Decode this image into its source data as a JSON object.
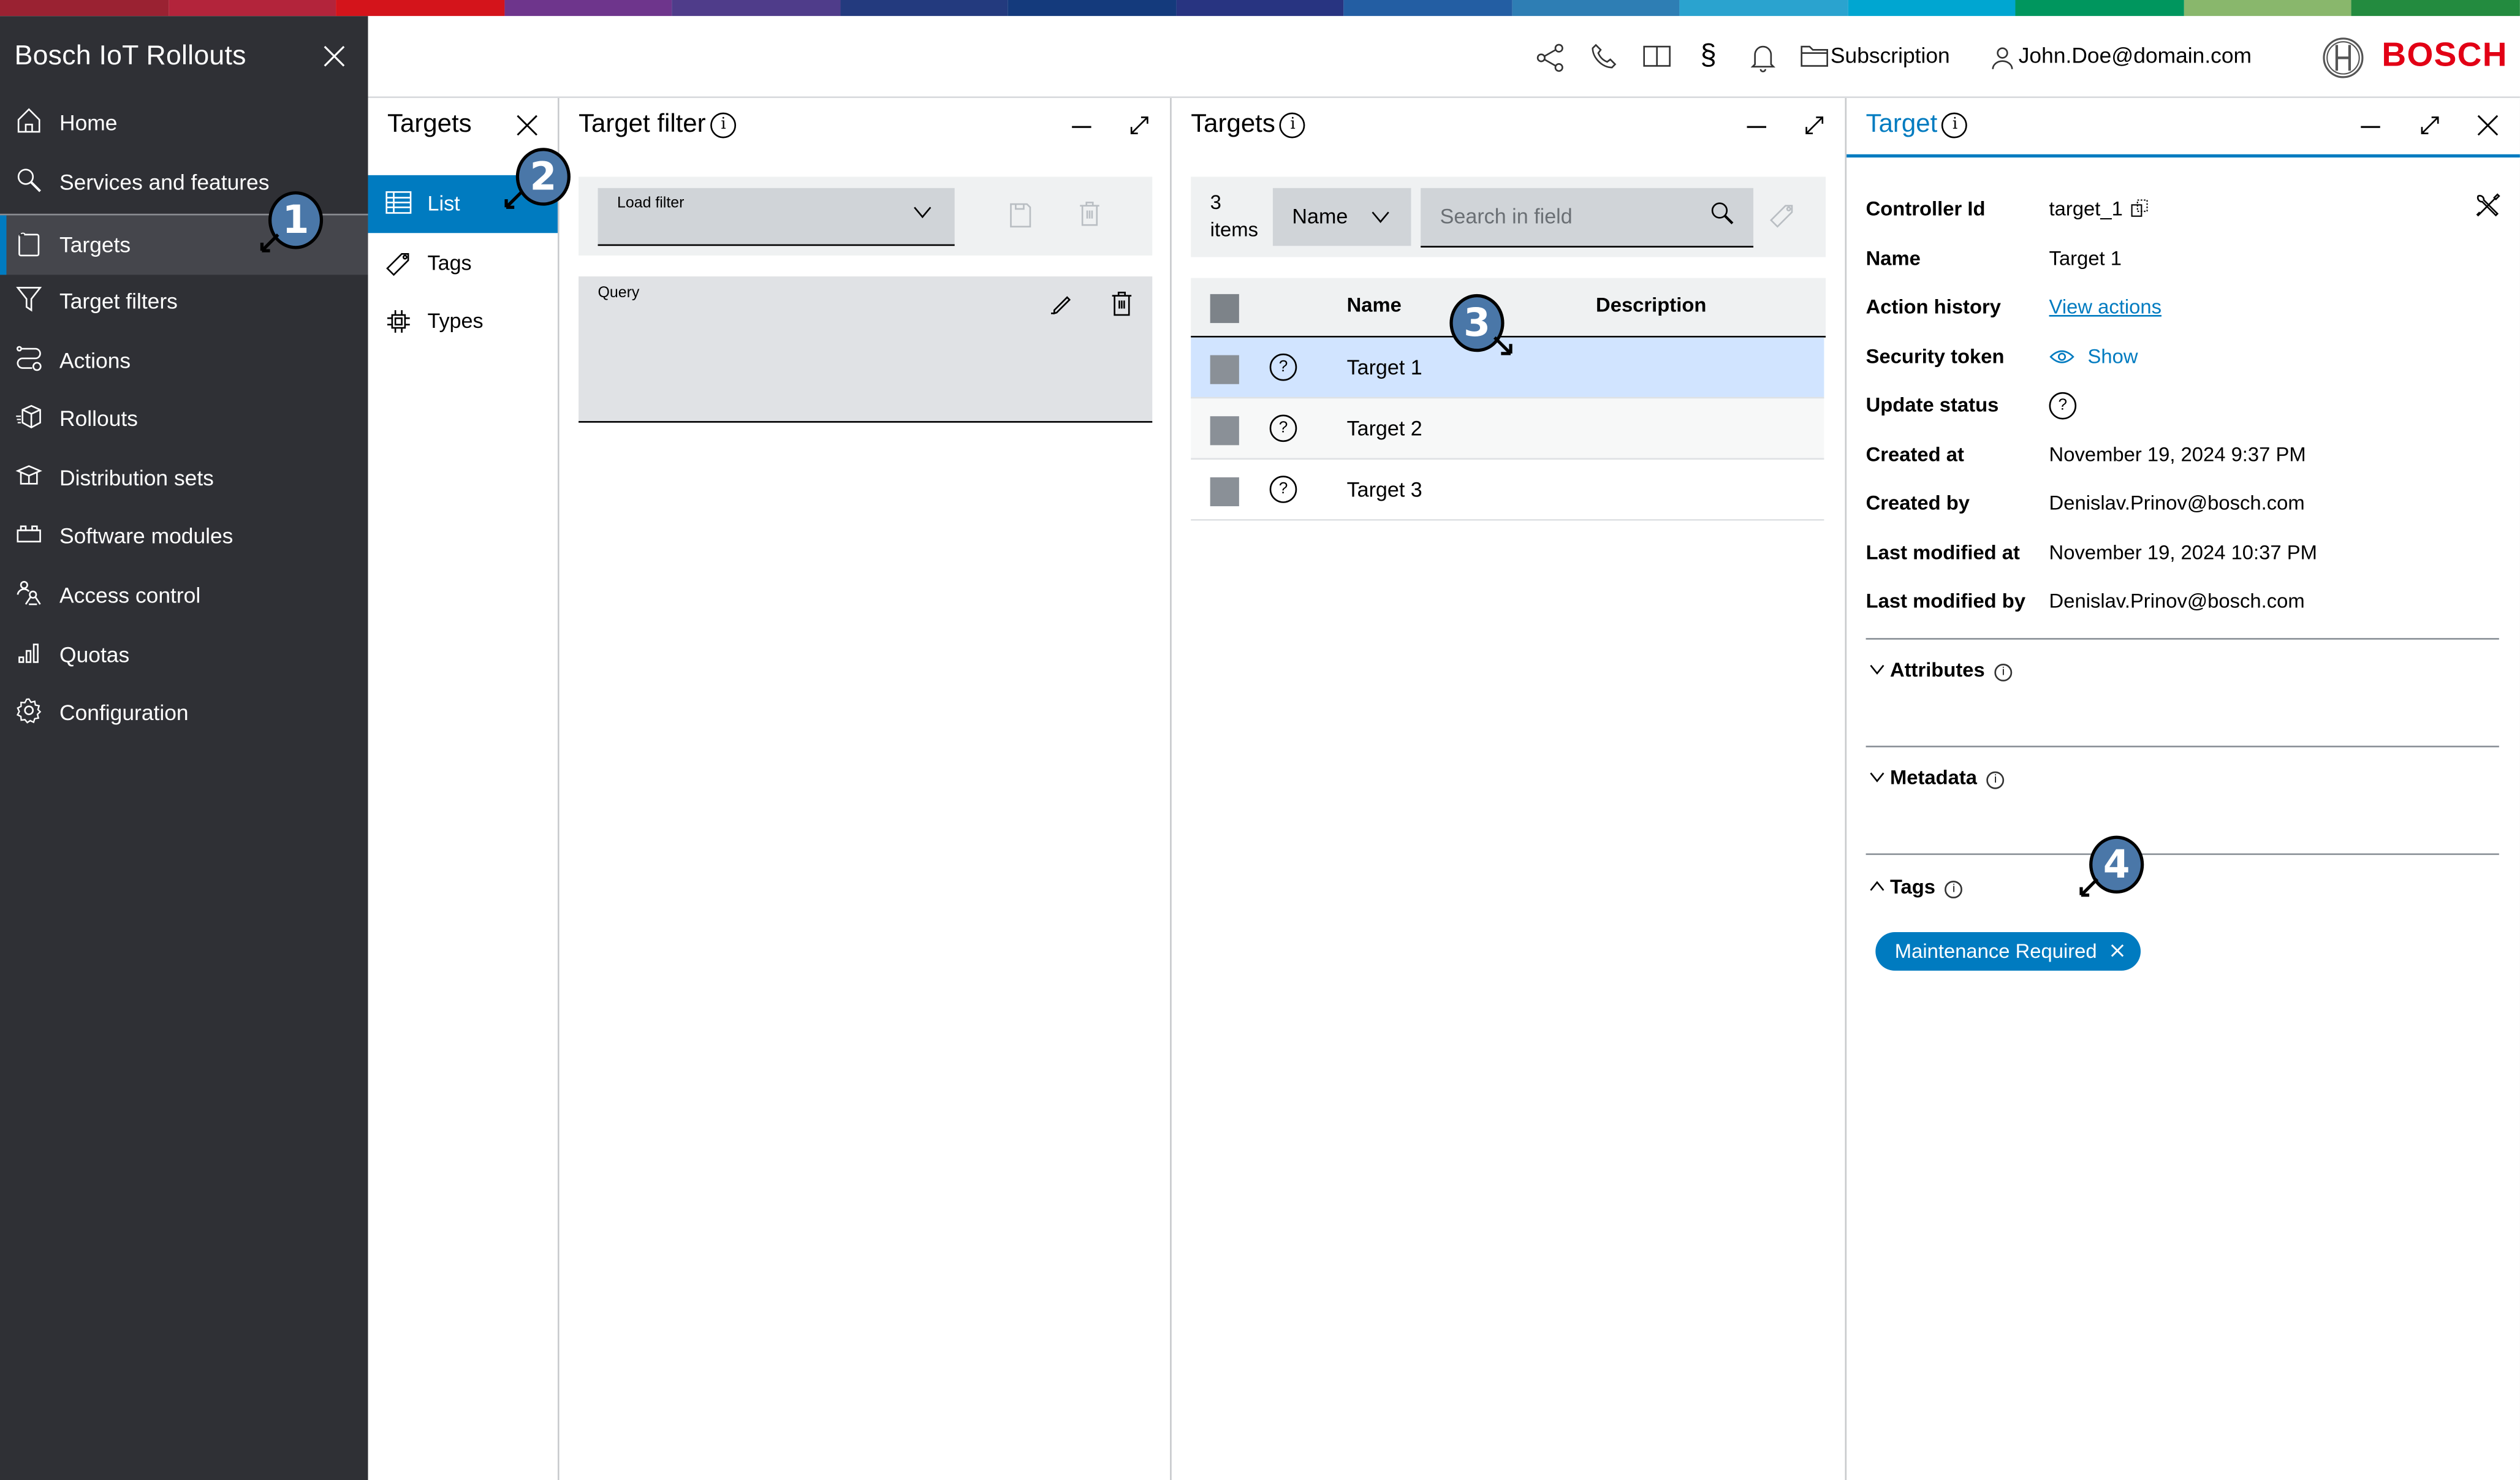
{
  "brand": {
    "supergraphic_colors": [
      "#9a2232",
      "#b3243b",
      "#d4141b",
      "#6e358c",
      "#4f3c8a",
      "#233a7e",
      "#143a7c",
      "#283481",
      "#235ea3",
      "#2e7eb4",
      "#2aa3cf",
      "#00a6d1",
      "#00965e",
      "#89b76c",
      "#238b3f"
    ],
    "accent": "#007bc0",
    "logo_text": "BOSCH",
    "logo_color": "#e20015"
  },
  "sidebar": {
    "app_title": "Bosch IoT Rollouts",
    "items": [
      {
        "label": "Home",
        "icon": "home-icon"
      },
      {
        "label": "Services and features",
        "icon": "search-icon"
      },
      {
        "label": "Targets",
        "icon": "device-icon",
        "active": true
      },
      {
        "label": "Target filters",
        "icon": "filter-icon"
      },
      {
        "label": "Actions",
        "icon": "actions-icon"
      },
      {
        "label": "Rollouts",
        "icon": "rollout-box-icon"
      },
      {
        "label": "Distribution sets",
        "icon": "open-box-icon"
      },
      {
        "label": "Software modules",
        "icon": "modules-icon"
      },
      {
        "label": "Access control",
        "icon": "user-keys-icon"
      },
      {
        "label": "Quotas",
        "icon": "bar-chart-icon"
      },
      {
        "label": "Configuration",
        "icon": "gear-icon"
      }
    ]
  },
  "header": {
    "icons": [
      "share-icon",
      "phone-icon",
      "book-icon",
      "paragraph-icon",
      "bell-icon"
    ],
    "subscription_label": "Subscription",
    "user_label": "John.Doe@domain.com"
  },
  "subnav": {
    "title": "Targets",
    "items": [
      {
        "label": "List",
        "icon": "list-table-icon",
        "active": true
      },
      {
        "label": "Tags",
        "icon": "tag-icon"
      },
      {
        "label": "Types",
        "icon": "chip-icon"
      }
    ]
  },
  "filter_panel": {
    "title": "Target filter",
    "load_filter_label": "Load filter",
    "query_label": "Query"
  },
  "targets_panel": {
    "title": "Targets",
    "count": "3",
    "count_unit": "items",
    "field_select": "Name",
    "search_placeholder": "Search in field",
    "columns": [
      "Name",
      "Description"
    ],
    "rows": [
      {
        "name": "Target 1",
        "description": "",
        "status": "unknown",
        "selected": true
      },
      {
        "name": "Target 2",
        "description": "",
        "status": "unknown"
      },
      {
        "name": "Target 3",
        "description": "",
        "status": "unknown"
      }
    ]
  },
  "detail_panel": {
    "title": "Target",
    "fields": [
      {
        "label": "Controller Id",
        "value": "target_1"
      },
      {
        "label": "Name",
        "value": "Target 1"
      },
      {
        "label": "Action history",
        "value": "View actions"
      },
      {
        "label": "Security token",
        "value": "Show"
      },
      {
        "label": "Update status",
        "value": "?"
      },
      {
        "label": "Created at",
        "value": "November 19, 2024 9:37 PM"
      },
      {
        "label": "Created by",
        "value": "Denislav.Prinov@bosch.com"
      },
      {
        "label": "Last modified at",
        "value": "November 19, 2024 10:37 PM"
      },
      {
        "label": "Last modified by",
        "value": "Denislav.Prinov@bosch.com"
      }
    ],
    "sections": [
      {
        "label": "Attributes",
        "expanded": false
      },
      {
        "label": "Metadata",
        "expanded": false
      },
      {
        "label": "Tags",
        "expanded": true
      }
    ],
    "tags": [
      "Maintenance Required"
    ]
  },
  "annotations": [
    "1",
    "2",
    "3",
    "4"
  ]
}
